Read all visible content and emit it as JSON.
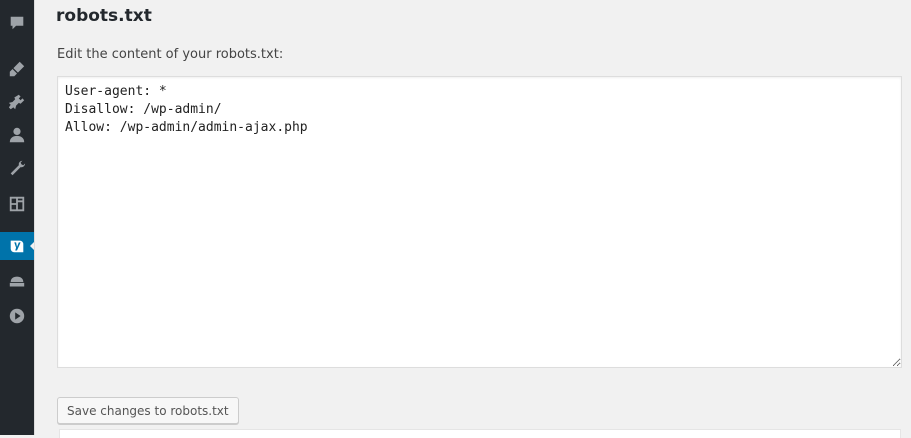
{
  "section": {
    "title": "robots.txt",
    "label": "Edit the content of your robots.txt:"
  },
  "editor": {
    "content": "User-agent: *\nDisallow: /wp-admin/\nAllow: /wp-admin/admin-ajax.php"
  },
  "actions": {
    "save_label": "Save changes to robots.txt"
  },
  "sidebar": {
    "icons": [
      "comments-icon",
      "appearance-icon",
      "plugins-icon",
      "users-icon",
      "tools-icon",
      "settings-icon",
      "yoast-seo-icon",
      "appliance-icon",
      "play-icon"
    ],
    "active_icon": "yoast-seo-icon"
  },
  "colors": {
    "sidebar_bg": "#23282d",
    "active_bg": "#0073aa",
    "page_bg": "#f1f1f1"
  }
}
